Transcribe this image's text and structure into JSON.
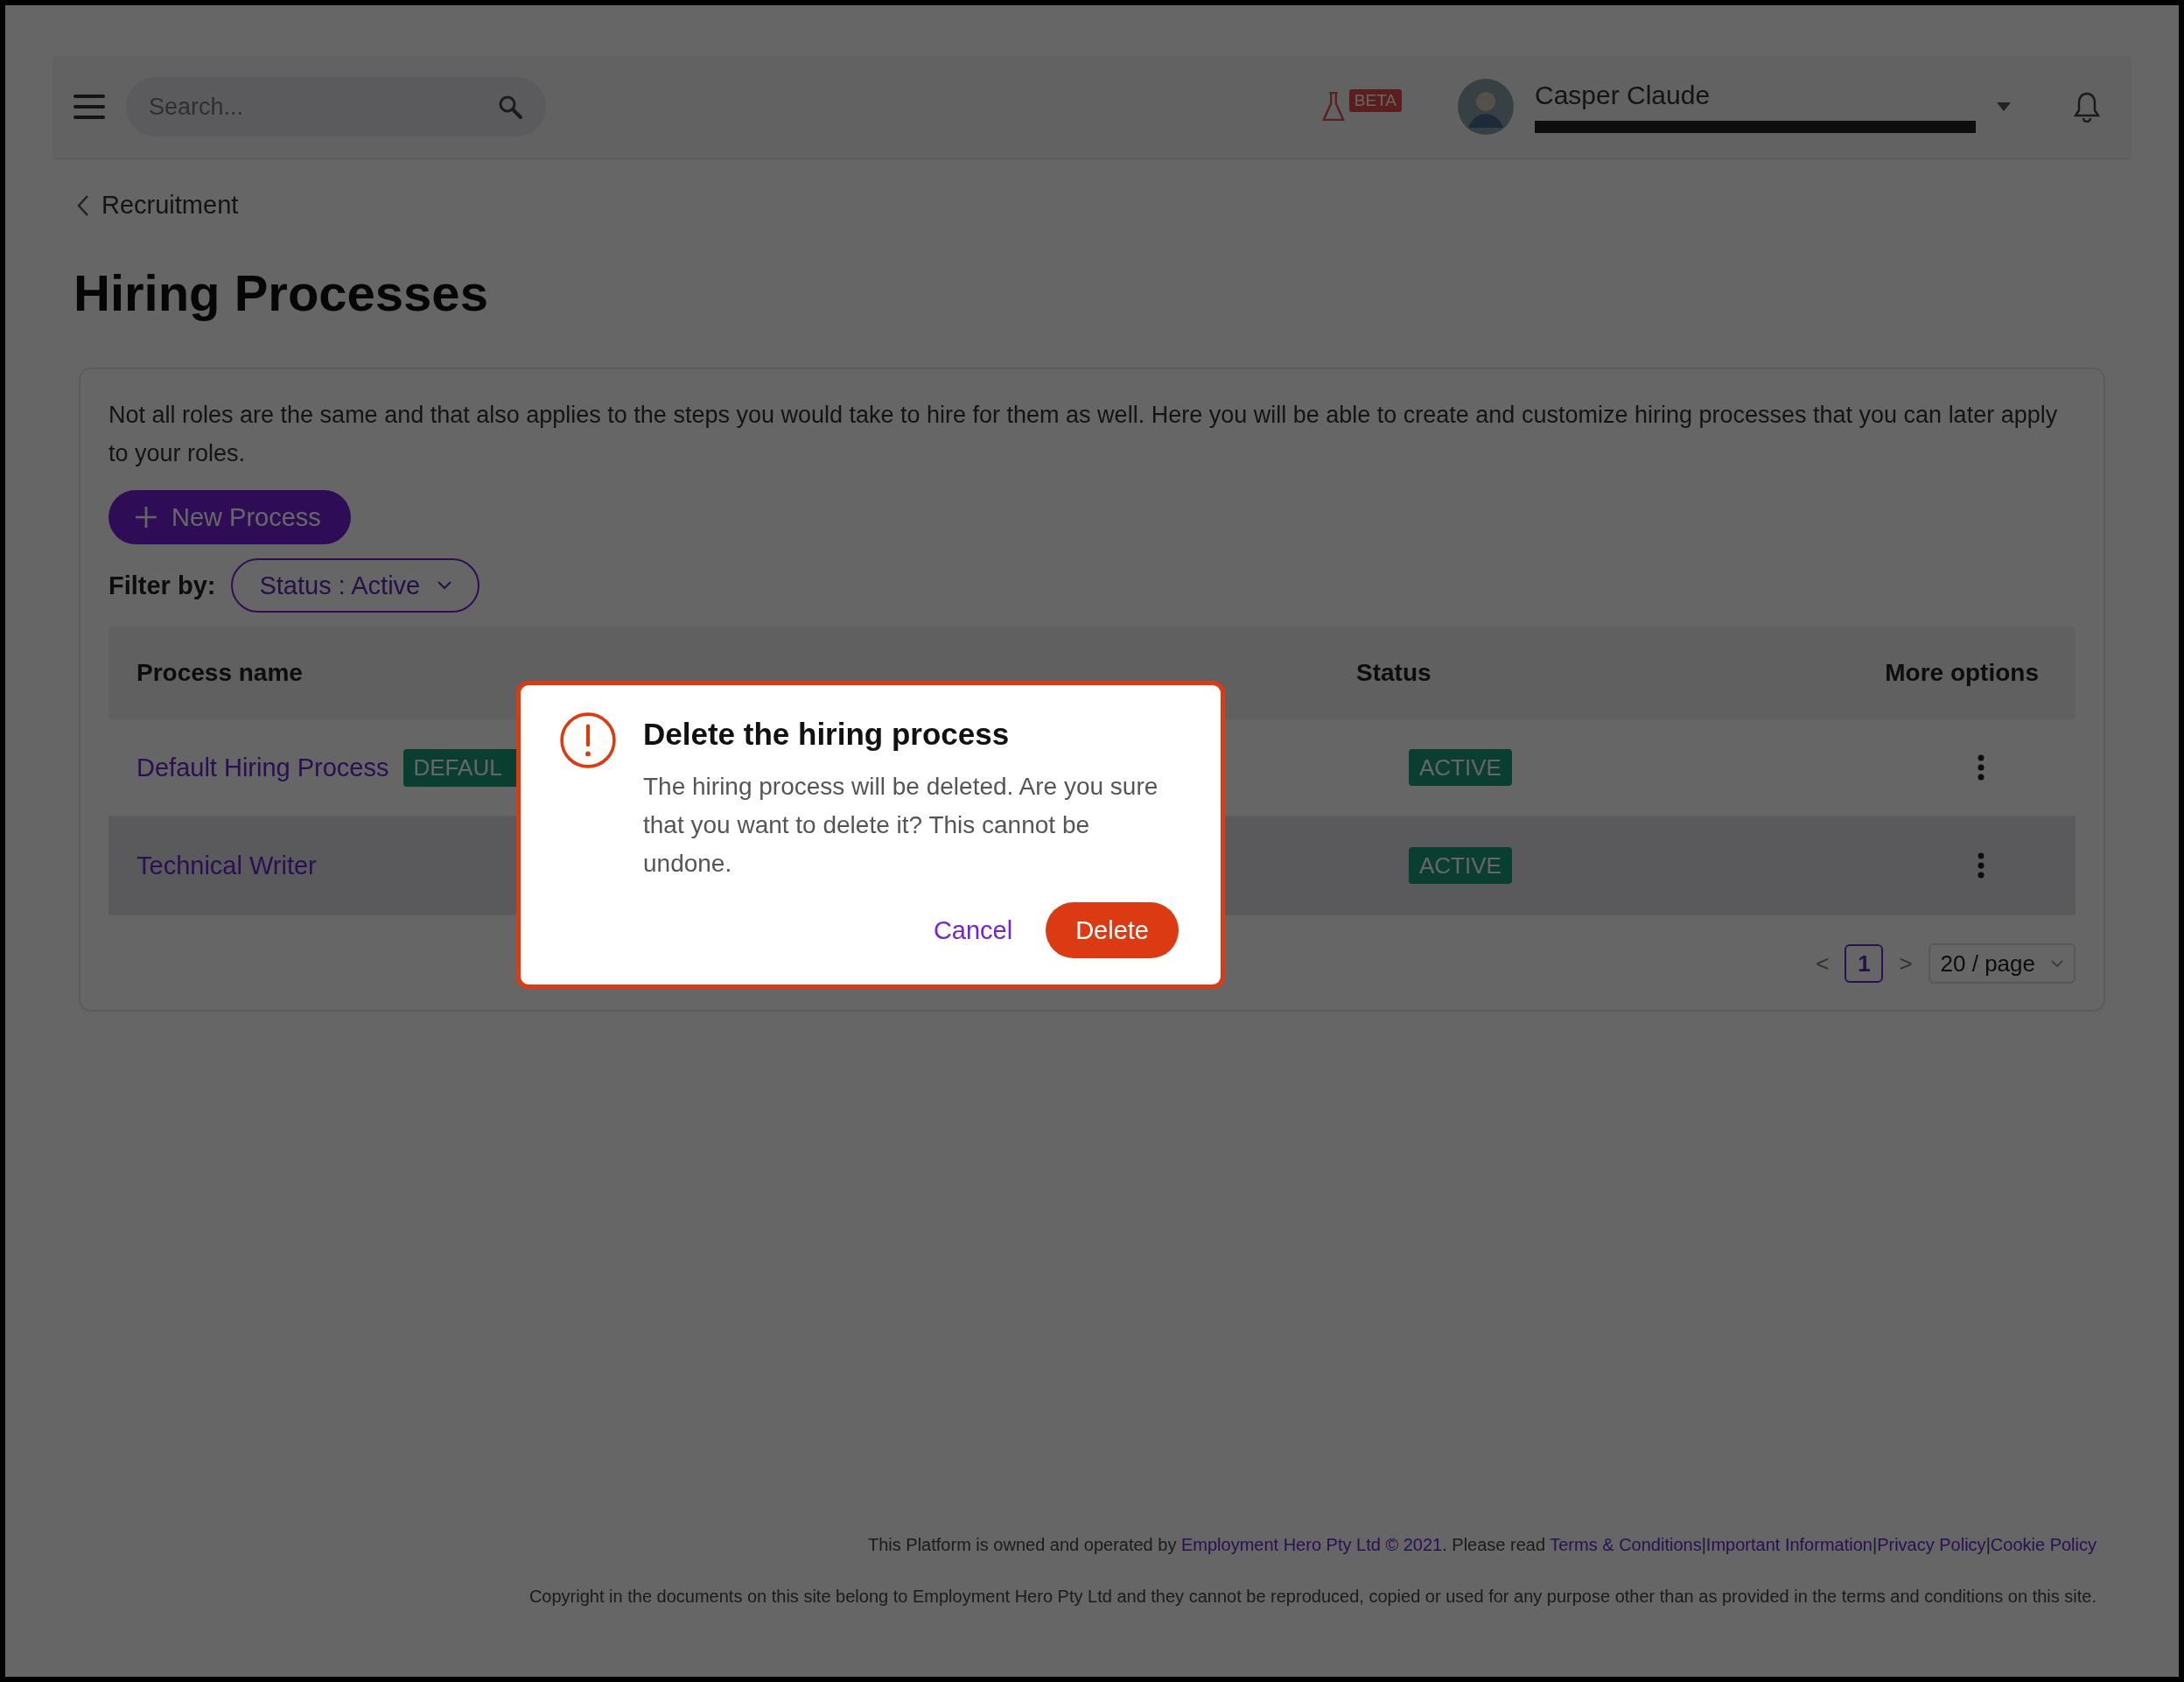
{
  "header": {
    "search": {
      "placeholder": "Search..."
    },
    "beta_badge": "BETA",
    "user": {
      "name": "Casper Claude"
    }
  },
  "breadcrumb": "Recruitment",
  "page_title": "Hiring Processes",
  "description": "Not all roles are the same and that also applies to the steps you would take to hire for them as well. Here you will be able to create and customize hiring processes that you can later apply to your roles.",
  "new_process_button": "New Process",
  "filter": {
    "label": "Filter by:",
    "value": "Status : Active"
  },
  "table": {
    "columns": [
      "Process name",
      "Status",
      "More options"
    ],
    "rows": [
      {
        "name": "Default Hiring Process",
        "badge": "DEFAUL",
        "status": "ACTIVE",
        "highlighted": false
      },
      {
        "name": "Technical Writer",
        "status": "ACTIVE",
        "highlighted": true
      }
    ]
  },
  "pagination": {
    "prev": "<",
    "pages": [
      {
        "label": "1",
        "selected": true
      }
    ],
    "next": ">",
    "page_size": "20 / page"
  },
  "dialog": {
    "title": "Delete the hiring process",
    "message": "The hiring process will be deleted. Are you sure that you want to delete it? This cannot be undone.",
    "cancel": "Cancel",
    "confirm": "Delete"
  },
  "footer": {
    "notice_prefix": "This Platform is owned and operated by",
    "owner_link": "Employment Hero Pty Ltd © 2021",
    "notice_middle": ". Please read",
    "links": [
      {
        "label": "Terms & Conditions"
      },
      {
        "label": "Important Information",
        "separator": "|"
      },
      {
        "label": "Privacy Policy",
        "separator": "|"
      },
      {
        "label": "Cookie Policy",
        "separator": "|"
      }
    ],
    "copyright": "Copyright in the documents on this site belong to Employment Hero Pty Ltd and they cannot be reproduced, copied or used for any purpose other than as provided in the terms and conditions on this site."
  }
}
